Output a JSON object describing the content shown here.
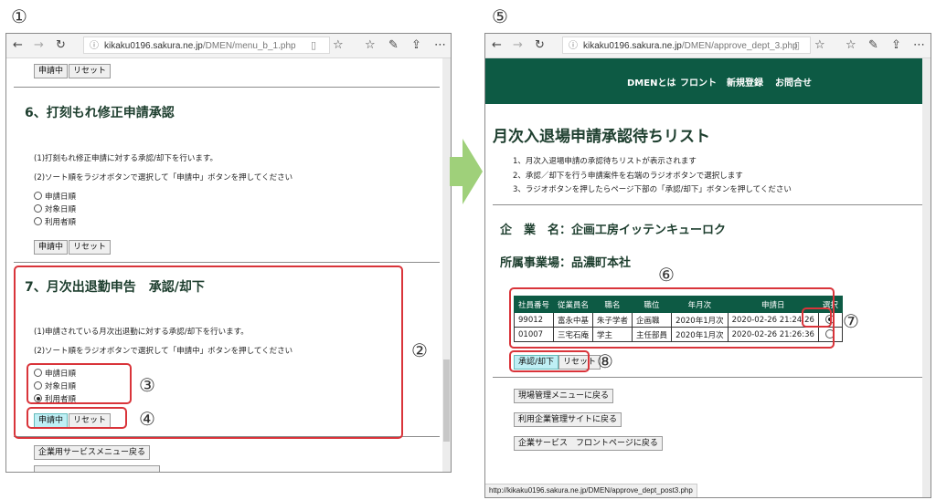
{
  "callouts": {
    "n1": "①",
    "n2": "②",
    "n3": "③",
    "n4": "④",
    "n5": "⑤",
    "n6": "⑥",
    "n7": "⑦",
    "n8": "⑧"
  },
  "left": {
    "url_prefix": "kikaku0196.sakura.ne.jp",
    "url_path": "/DMEN/menu_b_1.php",
    "top_buttons": {
      "submit": "申請中",
      "reset": "リセット"
    },
    "sec6": {
      "title": "6、打刻もれ修正申請承認",
      "line1": "(1)打刻もれ修正申請に対する承認/却下を行います。",
      "line2": "(2)ソート順をラジオボタンで選択して「申請中」ボタンを押してください",
      "radios": [
        "申請日順",
        "対象日順",
        "利用者順"
      ],
      "submit": "申請中",
      "reset": "リセット"
    },
    "sec7": {
      "title": "7、月次出退勤申告　承認/却下",
      "line1": "(1)申請されている月次出退勤に対する承認/却下を行います。",
      "line2": "(2)ソート順をラジオボタンで選択して「申請中」ボタンを押してください",
      "radios": [
        "申請日順",
        "対象日順",
        "利用者順"
      ],
      "submit": "申請中",
      "reset": "リセット"
    },
    "bottom_button": "企業用サービスメニュー戻る"
  },
  "right": {
    "url_prefix": "kikaku0196.sakura.ne.jp",
    "url_path": "/DMEN/approve_dept_3.php",
    "nav": [
      "DMENとは",
      "フロント",
      "新規登録",
      "お問合せ"
    ],
    "title": "月次入退場申請承認待ちリスト",
    "notes": [
      "1、月次入退場申請の承認待ちリストが表示されます",
      "2、承認／却下を行う申請案件を右端のラジオボタンで選択します",
      "3、ラジオボタンを押したらページ下部の「承認/却下」ボタンを押してください"
    ],
    "company_label": "企　業　名：",
    "company_value": "企画工房イッテンキューロク",
    "office_label": "所属事業場：",
    "office_value": "品濃町本社",
    "table": {
      "headers": [
        "社員番号",
        "従業員名",
        "職名",
        "職位",
        "年月次",
        "申請日",
        "選択"
      ],
      "rows": [
        [
          "99012",
          "富永中基",
          "朱子学者",
          "企画職",
          "2020年1月次",
          "2020-02-26 21:24:26"
        ],
        [
          "01007",
          "三宅石庵",
          "学主",
          "主任部員",
          "2020年1月次",
          "2020-02-26 21:26:36"
        ]
      ]
    },
    "approve": "承認/却下",
    "reset": "リセット",
    "links": [
      "現場管理メニューに戻る",
      "利用企業管理サイトに戻る",
      "企業サービス　フロントページに戻る"
    ],
    "status_url": "http://kikaku0196.sakura.ne.jp/DMEN/approve_dept_post3.php"
  },
  "colors": {
    "accent": "#0d5a44",
    "callout_red": "#d9343a",
    "arrow": "#9fd07a"
  }
}
